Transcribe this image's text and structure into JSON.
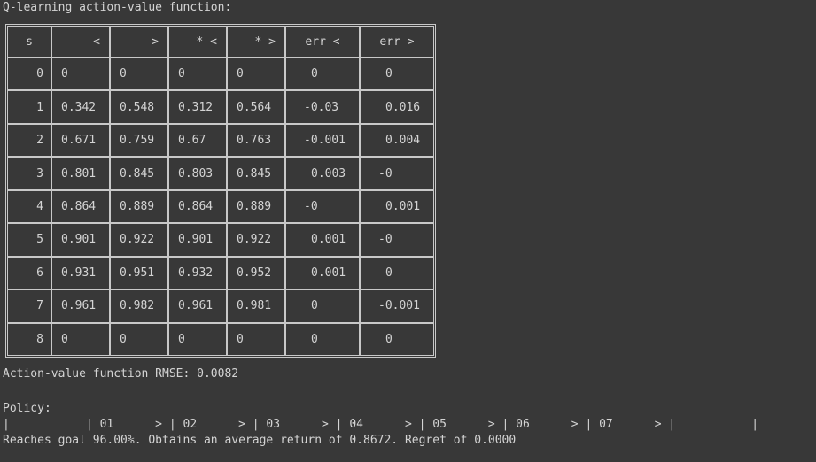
{
  "title": "Q-learning action-value function:",
  "table": {
    "headers": [
      "s",
      "<",
      ">",
      "* <",
      "* >",
      "err <",
      "err >"
    ],
    "rows": [
      [
        "0",
        "0",
        "0",
        "0",
        "0",
        "0",
        "0"
      ],
      [
        "1",
        "0.342",
        "0.548",
        "0.312",
        "0.564",
        "-0.03",
        "0.016"
      ],
      [
        "2",
        "0.671",
        "0.759",
        "0.67",
        "0.763",
        "-0.001",
        "0.004"
      ],
      [
        "3",
        "0.801",
        "0.845",
        "0.803",
        "0.845",
        "0.003",
        "-0"
      ],
      [
        "4",
        "0.864",
        "0.889",
        "0.864",
        "0.889",
        "-0",
        "0.001"
      ],
      [
        "5",
        "0.901",
        "0.922",
        "0.901",
        "0.922",
        "0.001",
        "-0"
      ],
      [
        "6",
        "0.931",
        "0.951",
        "0.932",
        "0.952",
        "0.001",
        "0"
      ],
      [
        "7",
        "0.961",
        "0.982",
        "0.961",
        "0.981",
        "0",
        "-0.001"
      ],
      [
        "8",
        "0",
        "0",
        "0",
        "0",
        "0",
        "0"
      ]
    ]
  },
  "rmse": "Action-value function RMSE: 0.0082",
  "policy_label": "Policy:",
  "policy_row": "|           | 01      > | 02      > | 03      > | 04      > | 05      > | 06      > | 07      > |           |",
  "summary": "Reaches goal 96.00%. Obtains an average return of 0.8672. Regret of 0.0000"
}
